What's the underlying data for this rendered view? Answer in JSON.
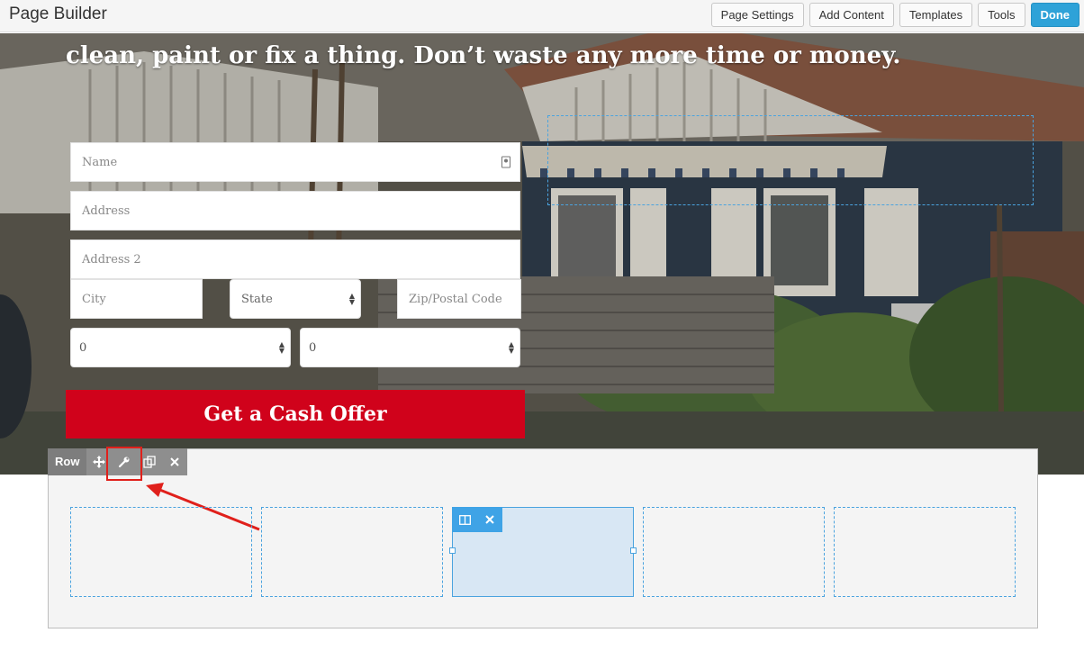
{
  "topbar": {
    "title": "Page Builder",
    "buttons": [
      "Page Settings",
      "Add Content",
      "Templates",
      "Tools",
      "Done"
    ]
  },
  "hero": {
    "headline": "clean, paint or fix a thing. Don’t waste any more time or money."
  },
  "form": {
    "name_placeholder": "Name",
    "address_placeholder": "Address",
    "address2_placeholder": "Address 2",
    "city_placeholder": "City",
    "state_value": "State",
    "zip_placeholder": "Zip/Postal Code",
    "select1_value": "0",
    "select2_value": "0",
    "submit_label": "Get a Cash Offer"
  },
  "row_toolbar": {
    "label": "Row",
    "icons": [
      "move-icon",
      "wrench-icon",
      "copy-icon",
      "close-icon"
    ]
  },
  "column_toolbar": {
    "icons": [
      "columns-icon",
      "close-icon"
    ]
  },
  "colors": {
    "accent": "#2ea2d8",
    "cta": "#d0021b",
    "annotation": "#e0201b",
    "guide": "#4aa3df"
  }
}
